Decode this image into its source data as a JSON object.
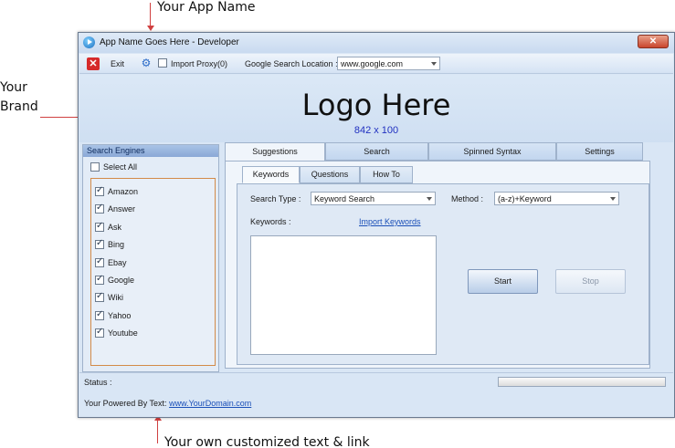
{
  "callouts": {
    "app_name": "Your App Name",
    "brand_line1": "Your",
    "brand_line2": "Brand",
    "custom_text": "Your own customized text & link"
  },
  "window": {
    "title": "App Name Goes Here - Developer",
    "close_glyph": "✕"
  },
  "toolbar": {
    "exit_label": "Exit",
    "import_proxy_label": "Import Proxy(0)",
    "import_proxy_checked": false,
    "search_location_label": "Google Search Location :",
    "search_location_value": "www.google.com"
  },
  "brand": {
    "logo_text": "Logo Here",
    "logo_size": "842 x 100"
  },
  "search_engines": {
    "header": "Search Engines",
    "select_all_label": "Select All",
    "select_all_checked": false,
    "items": [
      {
        "label": "Amazon",
        "checked": true
      },
      {
        "label": "Answer",
        "checked": true
      },
      {
        "label": "Ask",
        "checked": true
      },
      {
        "label": "Bing",
        "checked": true
      },
      {
        "label": "Ebay",
        "checked": true
      },
      {
        "label": "Google",
        "checked": true
      },
      {
        "label": "Wiki",
        "checked": true
      },
      {
        "label": "Yahoo",
        "checked": true
      },
      {
        "label": "Youtube",
        "checked": true
      }
    ]
  },
  "main_tabs": [
    "Suggestions",
    "Search",
    "Spinned Syntax",
    "Settings"
  ],
  "active_main_tab": "Suggestions",
  "sub_tabs": [
    "Keywords",
    "Questions",
    "How To"
  ],
  "active_sub_tab": "Keywords",
  "keywords_panel": {
    "search_type_label": "Search Type :",
    "search_type_value": "Keyword Search",
    "method_label": "Method :",
    "method_value": "(a-z)+Keyword",
    "keywords_label": "Keywords :",
    "import_keywords_link": "Import Keywords",
    "start_label": "Start",
    "stop_label": "Stop"
  },
  "status": {
    "label": "Status :",
    "powered_prefix": "Your Powered By Text:",
    "powered_link": "www.YourDomain.com"
  },
  "colors": {
    "arrow": "#d04040",
    "link": "#1a4fb8",
    "logo_size_text": "#2030c0"
  }
}
